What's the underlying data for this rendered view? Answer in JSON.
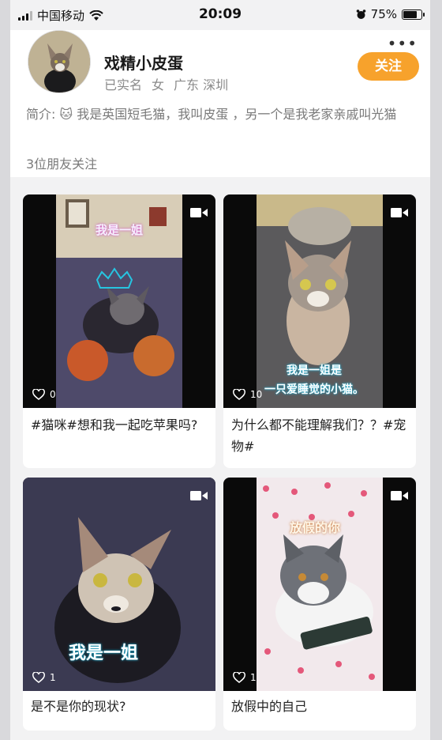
{
  "status_bar": {
    "carrier": "中国移动",
    "time": "20:09",
    "battery": "75%",
    "battery_level": 0.75
  },
  "profile": {
    "name": "戏精小皮蛋",
    "verified": "已实名",
    "gender": "女",
    "province": "广东",
    "city": "深圳",
    "follow_label": "关注",
    "bio": "简介: 🐱 我是英国短毛猫，我叫皮蛋 ，另一个是我老家亲戚叫光猫",
    "friends_following": "3位朋友关注"
  },
  "colors": {
    "accent": "#f7a22c"
  },
  "videos": [
    {
      "caption": "#猫咪#想和我一起吃苹果吗?",
      "likes": "0",
      "overlay": "我是一姐",
      "icon": "video-camera-icon"
    },
    {
      "caption": "为什么都不能理解我们？？#宠物#",
      "likes": "10",
      "overlay_line1": "我是一姐是",
      "overlay_line2": "一只爱睡觉的小猫。",
      "icon": "video-camera-icon"
    },
    {
      "caption": "是不是你的现状?",
      "likes": "1",
      "overlay": "我是一姐",
      "icon": "video-camera-icon"
    },
    {
      "caption": "放假中的自己",
      "likes": "1",
      "overlay": "放假的你",
      "icon": "video-camera-icon"
    }
  ]
}
